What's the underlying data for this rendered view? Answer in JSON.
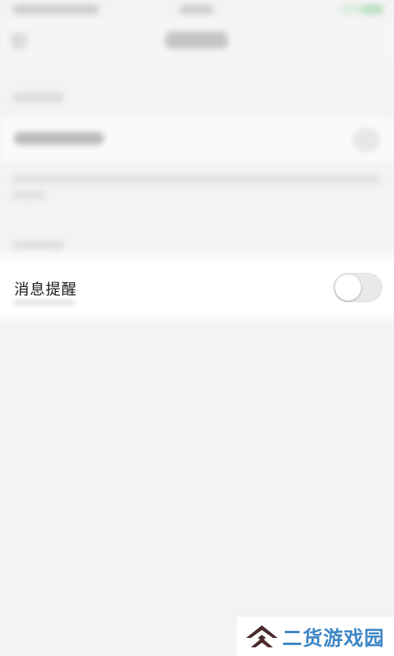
{
  "settings_row": {
    "label": "消息提醒",
    "toggle_state": "off"
  },
  "watermark": {
    "text": "二货游戏园",
    "icon": "double-chevron-up-logo-icon",
    "color": "#3d86c6"
  },
  "colors": {
    "background": "#f3f3f3",
    "row_background": "#ffffff",
    "toggle_off": "#e9e9e9"
  }
}
